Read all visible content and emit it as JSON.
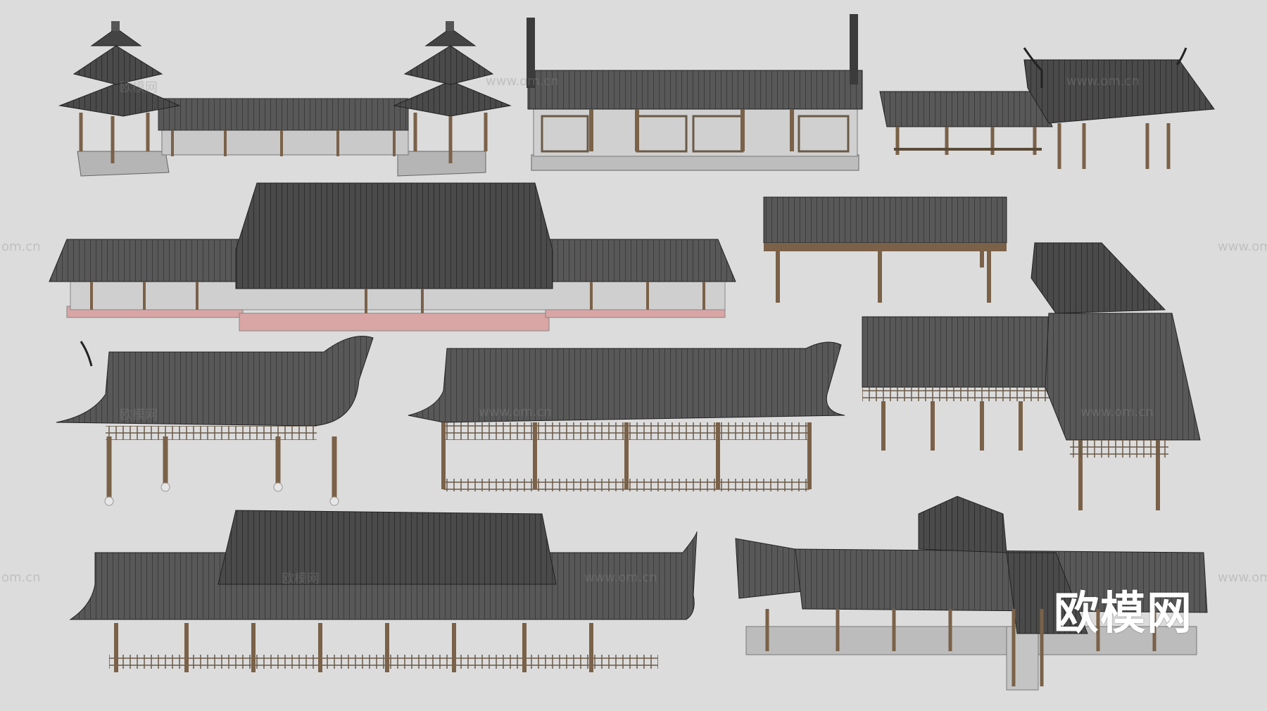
{
  "brand": {
    "logo_text": "欧模网"
  },
  "watermark": {
    "site": "www.om.cn",
    "site_short": "om.cn",
    "cn": "欧模网"
  },
  "colors": {
    "background": "#dcdcdc",
    "roof": "#555555",
    "roof_dark": "#3a3a3a",
    "timber": "#7a6148",
    "floor": "#c8c8c8",
    "stone_base": "#b8b8b8",
    "pink_plinth": "#d9a5a5"
  }
}
